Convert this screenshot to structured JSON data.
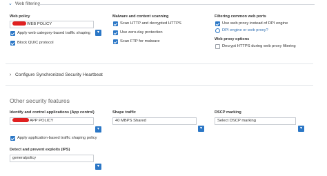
{
  "web_filtering": {
    "title": "Web filtering"
  },
  "web_policy": {
    "label": "Web policy",
    "value": "WEB POLICY",
    "checkboxes": [
      {
        "label": "Apply web category-based traffic shaping",
        "checked": true
      },
      {
        "label": "Block QUIC protocol",
        "checked": true
      }
    ]
  },
  "malware": {
    "label": "Malware and content scanning",
    "checkboxes": [
      {
        "label": "Scan HTTP and decrypted HTTPS",
        "checked": true
      },
      {
        "label": "Use zero-day protection",
        "checked": true
      },
      {
        "label": "Scan FTP for malware",
        "checked": true
      }
    ]
  },
  "filtering_ports": {
    "label": "Filtering common web ports",
    "checkbox": {
      "label": "Use web proxy instead of DPI engine",
      "checked": true
    },
    "radio": {
      "label": "DPI engine or web proxy?"
    }
  },
  "proxy_options": {
    "label": "Web proxy options",
    "checkbox": {
      "label": "Decrypt HTTPS during web proxy filtering",
      "checked": false
    }
  },
  "heartbeat": {
    "title": "Configure Synchronized Security Heartbeat"
  },
  "other_security": {
    "title": "Other security features",
    "app_control": {
      "label": "Identify and control applications (App control)",
      "value": "APP POLICY",
      "checkbox": {
        "label": "Apply application-based traffic shaping policy",
        "checked": true
      }
    },
    "shape_traffic": {
      "label": "Shape traffic",
      "value": "40 MBPS Shared"
    },
    "dscp": {
      "label": "DSCP marking",
      "value": "Select DSCP marking"
    },
    "ips": {
      "label": "Detect and prevent exploits (IPS)",
      "value": "generalpolicy"
    }
  },
  "icons": {
    "dropdown": "chevron-down-icon",
    "expand": "chevron-right-icon",
    "collapse": "chevron-down-icon"
  },
  "colors": {
    "accent": "#2b77c6",
    "redaction": "#e02020"
  }
}
